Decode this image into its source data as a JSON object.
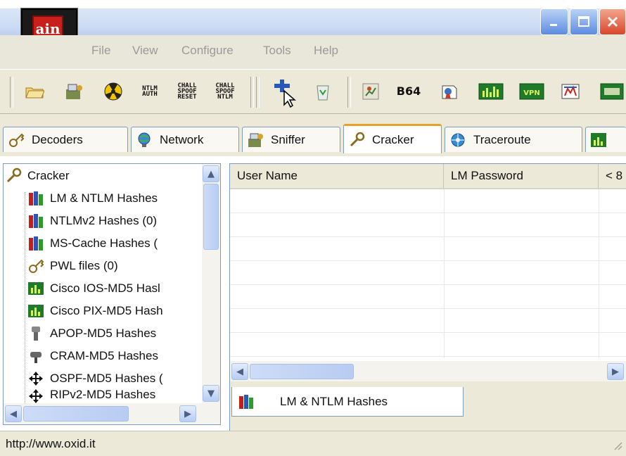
{
  "app": {
    "logo_text": "ain"
  },
  "menu": {
    "items": [
      "File",
      "View",
      "Configure",
      "Tools",
      "Help"
    ]
  },
  "toolbar": {
    "ntlm_auth": "NTLM AUTH",
    "chall_spoof_reset": "CHALL SPOOF RESET",
    "chall_spoof_ntlm": "CHALL SPOOF NTLM",
    "b64": "B64"
  },
  "tabs": [
    {
      "label": "Decoders",
      "icon": "key-icon"
    },
    {
      "label": "Network",
      "icon": "globe-icon"
    },
    {
      "label": "Sniffer",
      "icon": "sniffer-icon"
    },
    {
      "label": "Cracker",
      "icon": "cracker-icon"
    },
    {
      "label": "Traceroute",
      "icon": "traceroute-icon"
    }
  ],
  "tree": {
    "root": "Cracker",
    "items": [
      "LM & NTLM Hashes",
      "NTLMv2 Hashes (0)",
      "MS-Cache Hashes (",
      "PWL files (0)",
      "Cisco IOS-MD5 Hasl",
      "Cisco PIX-MD5 Hash",
      "APOP-MD5 Hashes",
      "CRAM-MD5 Hashes",
      "OSPF-MD5 Hashes (",
      "RIPv2-MD5 Hashes"
    ]
  },
  "table": {
    "columns": [
      "User Name",
      "LM Password",
      "< 8"
    ]
  },
  "bottom_tab": {
    "label": "LM & NTLM Hashes"
  },
  "status": {
    "text": "http://www.oxid.it"
  },
  "colors": {
    "accent": "#316ac5",
    "logo_red": "#c8201a"
  }
}
